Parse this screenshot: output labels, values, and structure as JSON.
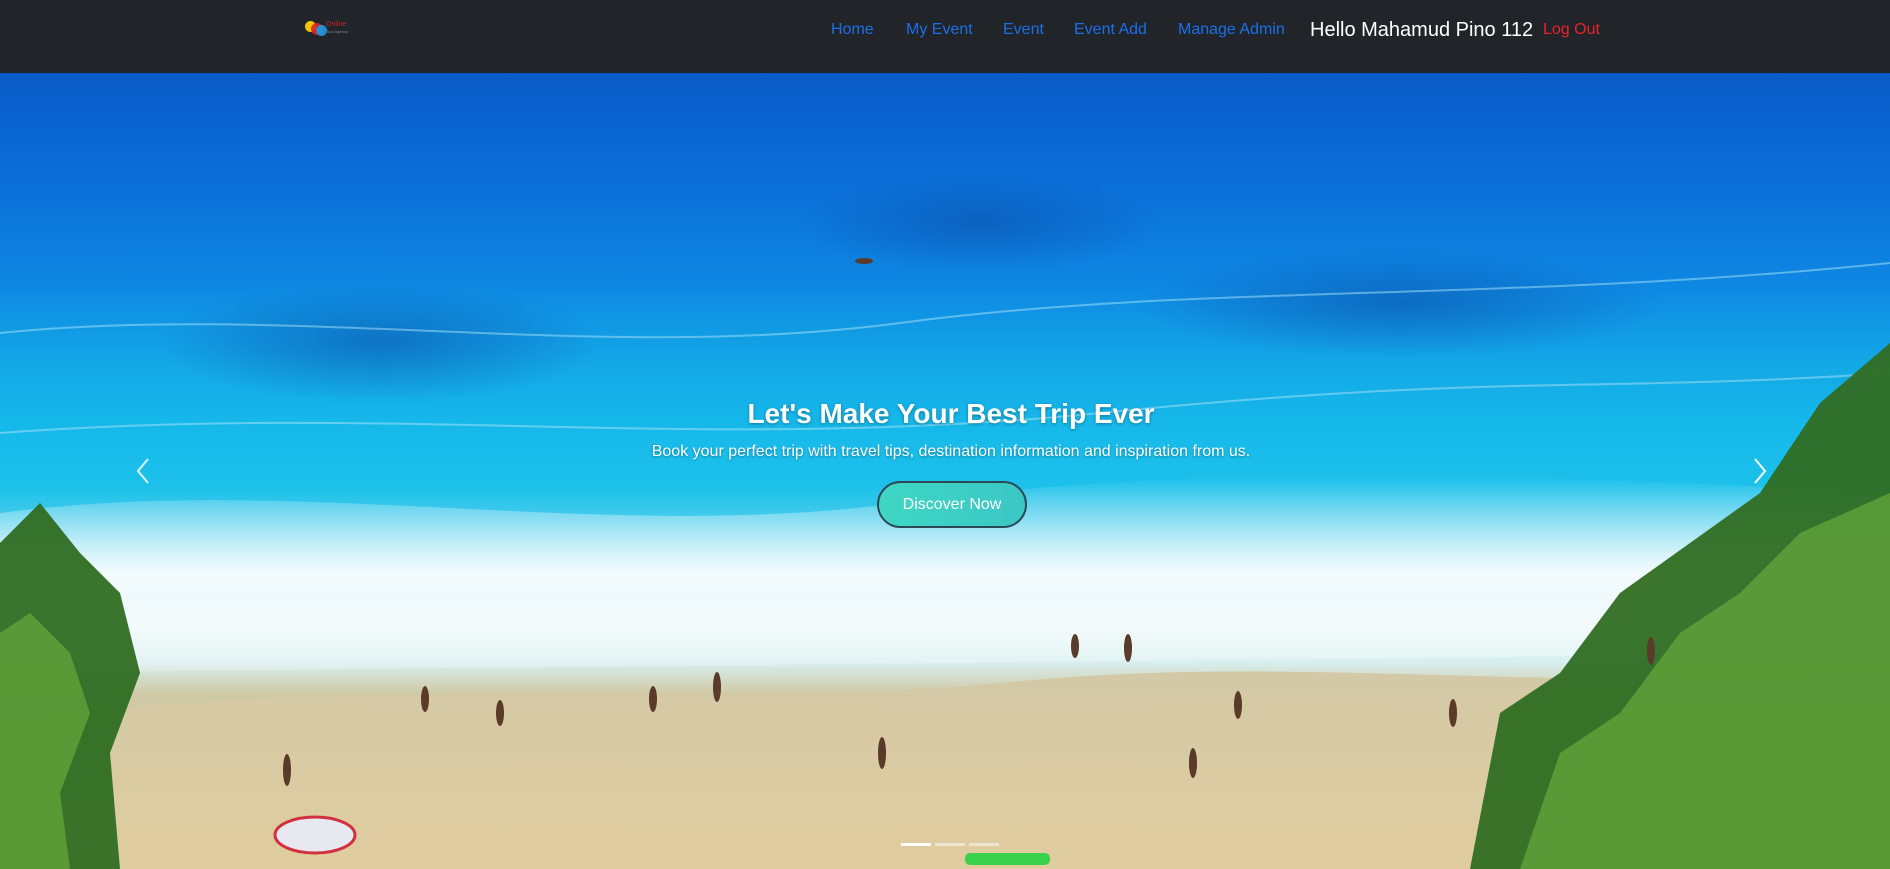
{
  "navbar": {
    "logo": {
      "text": "Online",
      "subtext": "Tour Agency"
    },
    "links": [
      {
        "label": "Home"
      },
      {
        "label": "My Event"
      },
      {
        "label": "Event"
      },
      {
        "label": "Event Add"
      },
      {
        "label": "Manage Admin"
      }
    ],
    "greeting": "Hello Mahamud Pino 112",
    "logout_label": "Log Out",
    "colors": {
      "background": "#212529",
      "link": "#1a6fe8",
      "logout": "#e8222d"
    }
  },
  "hero": {
    "title": "Let's Make Your Best Trip Ever",
    "subtitle": "Book your perfect trip with travel tips, destination information and inspiration from us.",
    "button_label": "Discover Now",
    "prev_icon": "chevron-left-icon",
    "next_icon": "chevron-right-icon",
    "slides_count": 3,
    "active_slide": 1,
    "colors": {
      "button": "#3ed6c4"
    }
  }
}
